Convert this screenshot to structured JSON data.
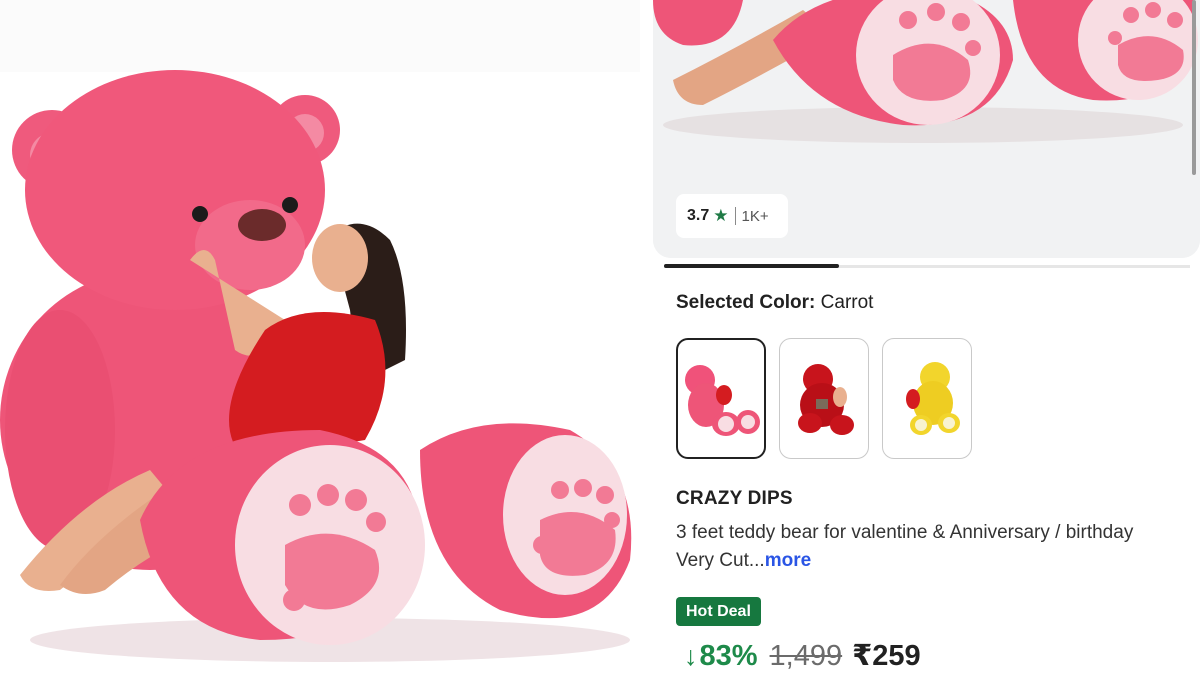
{
  "product_image": {
    "alt_icon": "teddy-bear-photo"
  },
  "gallery": {
    "image_icon": "teddy-bear-paws-photo"
  },
  "rating": {
    "value": "3.7",
    "star": "★",
    "count": "1K+"
  },
  "color_selection": {
    "label": "Selected Color:",
    "value": "Carrot",
    "swatches": [
      {
        "name": "pink-bear",
        "color": "#f0527a",
        "selected": true
      },
      {
        "name": "red-bear",
        "color": "#c8141c",
        "selected": false
      },
      {
        "name": "yellow-bear",
        "color": "#f2d52c",
        "selected": false
      }
    ]
  },
  "product": {
    "brand": "CRAZY DIPS",
    "title": "3 feet teddy bear for valentine & Anniversary / birthday Very Cut...",
    "more": "more"
  },
  "deal": {
    "badge": "Hot Deal"
  },
  "pricing": {
    "arrow": "↓",
    "discount": "83%",
    "mrp": "1,499",
    "price": "₹259"
  },
  "colors": {
    "accent_green": "#16783f",
    "discount_green": "#1e8a4a",
    "link_blue": "#2a55e5",
    "bear_pink": "#f0527a"
  }
}
